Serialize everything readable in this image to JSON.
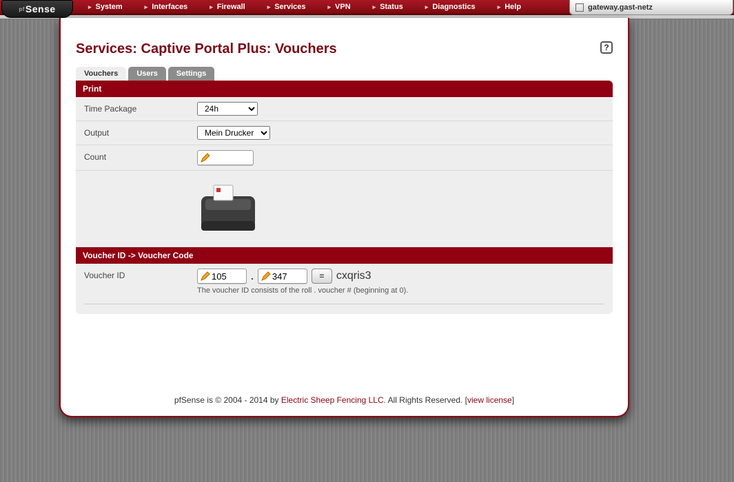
{
  "logo": "Sense",
  "menu": {
    "items": [
      "System",
      "Interfaces",
      "Firewall",
      "Services",
      "VPN",
      "Status",
      "Diagnostics",
      "Help"
    ]
  },
  "hostname": "gateway.gast-netz",
  "page": {
    "title": "Services: Captive Portal Plus: Vouchers"
  },
  "tabs": [
    "Vouchers",
    "Users",
    "Settings"
  ],
  "active_tab": 0,
  "print": {
    "header": "Print",
    "time_label": "Time Package",
    "time_options": [
      "24h"
    ],
    "time_selected": "24h",
    "output_label": "Output",
    "output_options": [
      "Mein Drucker"
    ],
    "output_selected": "Mein Drucker",
    "count_label": "Count",
    "count_value": ""
  },
  "lookup": {
    "header": "Voucher ID -> Voucher Code",
    "label": "Voucher ID",
    "roll": "105",
    "number": "347",
    "equals": "=",
    "result": "cxqris3",
    "hint": "The voucher ID consists of the roll . voucher # (beginning at 0)."
  },
  "footer": {
    "pre": "pfSense is © 2004 - 2014 by ",
    "link1": "Electric Sheep Fencing LLC",
    "mid": ". All Rights Reserved. [",
    "link2": "view license",
    "post": "]"
  }
}
